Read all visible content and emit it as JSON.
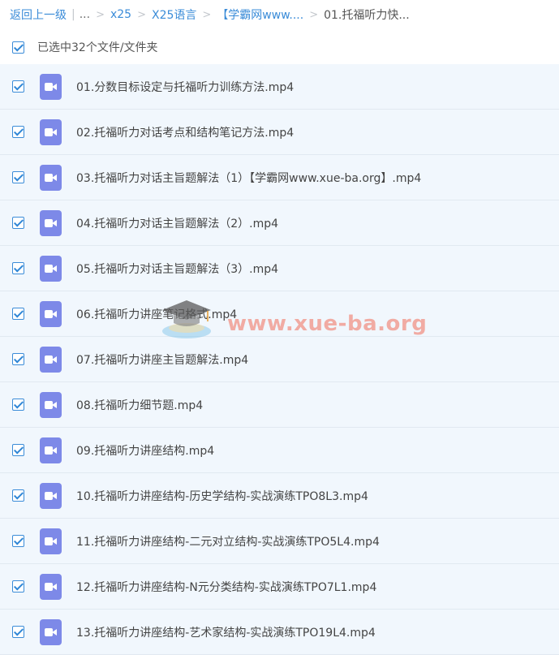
{
  "breadcrumb": {
    "back": "返回上一级",
    "ellipsis": "...",
    "items": [
      "x25",
      "X25语言",
      "【学霸网www...."
    ],
    "current": "01.托福听力快..."
  },
  "selection": {
    "checked": true,
    "label": "已选中32个文件/文件夹"
  },
  "file_icon": "video-file-icon",
  "files": [
    "01.分数目标设定与托福听力训练方法.mp4",
    "02.托福听力对话考点和结构笔记方法.mp4",
    "03.托福听力对话主旨题解法（1）【学霸网www.xue-ba.org】.mp4",
    "04.托福听力对话主旨题解法（2）.mp4",
    "05.托福听力对话主旨题解法（3）.mp4",
    "06.托福听力讲座笔记格式.mp4",
    "07.托福听力讲座主旨题解法.mp4",
    "08.托福听力细节题.mp4",
    "09.托福听力讲座结构.mp4",
    "10.托福听力讲座结构-历史学结构-实战演练TPO8L3.mp4",
    "11.托福听力讲座结构-二元对立结构-实战演练TPO5L4.mp4",
    "12.托福听力讲座结构-N元分类结构-实战演练TPO7L1.mp4",
    "13.托福听力讲座结构-艺术家结构-实战演练TPO19L4.mp4"
  ],
  "watermark": {
    "text": "www.xue-ba.org"
  },
  "colors": {
    "link": "#3b8cd8",
    "row_bg": "#f1f7fd",
    "icon": "#7d89e8"
  }
}
